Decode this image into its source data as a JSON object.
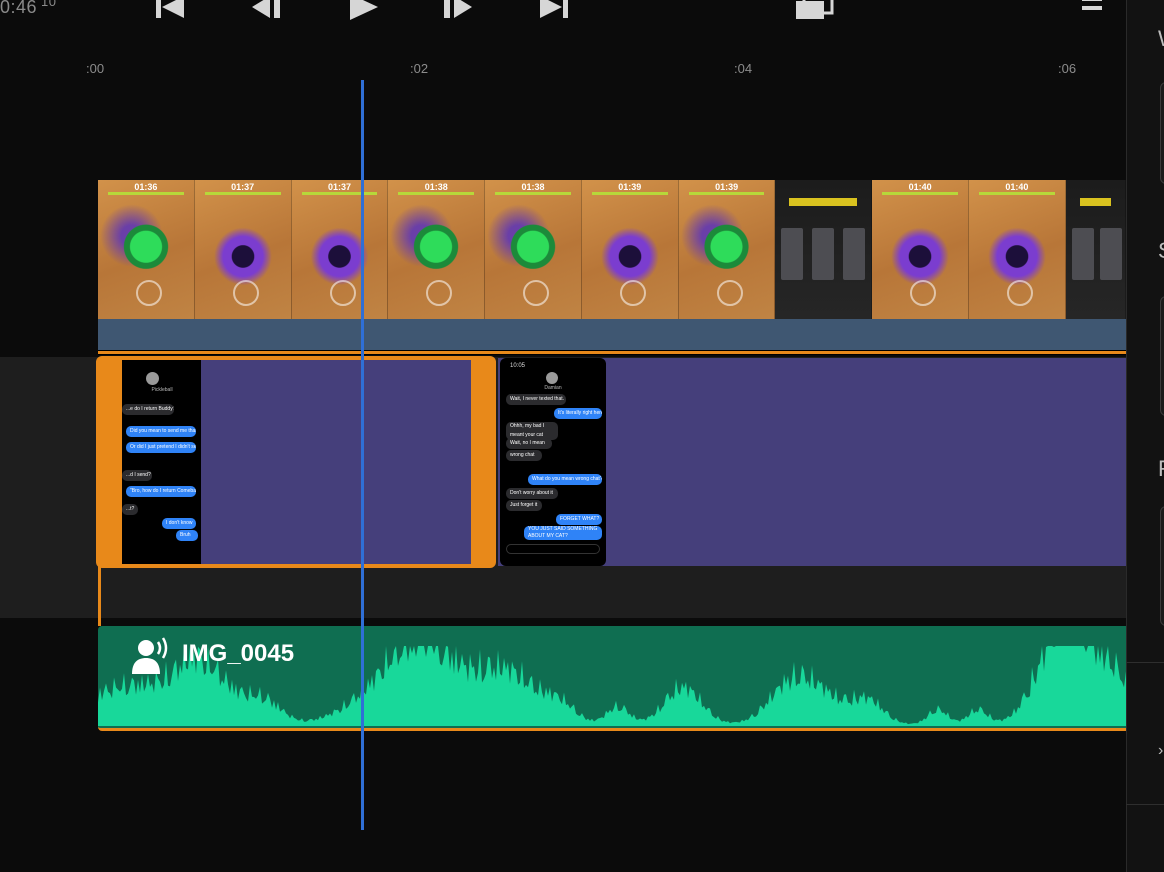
{
  "timecode": {
    "main": "0:46",
    "frames": "10"
  },
  "transport": {
    "skip_back": "skip-to-start-icon",
    "step_back": "step-back-icon",
    "play": "play-icon",
    "step_forward": "step-forward-icon",
    "skip_forward": "skip-to-end-icon",
    "fullscreen": "aspect-ratio-icon",
    "menu": "hamburger-menu-icon"
  },
  "ruler": {
    "ticks": [
      ":00",
      ":02",
      ":04",
      ":06"
    ]
  },
  "video_track": {
    "thumb_timestamps": [
      "01:36",
      "01:37",
      "01:37",
      "01:38",
      "01:38",
      "01:39",
      "01:39",
      "",
      "01:40",
      "01:40",
      ""
    ]
  },
  "overlay_clips": {
    "clip1": {
      "messages": [
        "Pickleball",
        "...e do I return\nBuddy's chat",
        "Did you mean to send me that to me?",
        "Or did I just pretend I didn't see it?",
        "...d I send?",
        "\"Bro, how do I return Comeback's chat\"",
        "...t?",
        "I don't know",
        "Bruh"
      ]
    },
    "clip2": {
      "status_time": "10:05",
      "contact": "Damian",
      "messages": [
        "Wait, I never texted that.",
        "It's literally right here.",
        "Ohhh, my bad I meant your cat",
        "Wait, no I mean",
        "wrong chat",
        "What do you mean wrong chat?",
        "Don't worry about it",
        "Just forget it",
        "FORGET WHAT?",
        "YOU JUST SAID SOMETHING ABOUT MY CAT?"
      ]
    }
  },
  "audio_track": {
    "name": "IMG_0045",
    "icon": "voiceover-icon"
  },
  "colors": {
    "selection": "#e8891a",
    "overlay_clip": "#453f7b",
    "audio_clip": "#0f6e51",
    "waveform": "#18d89a",
    "playhead": "#2f6fd6"
  }
}
